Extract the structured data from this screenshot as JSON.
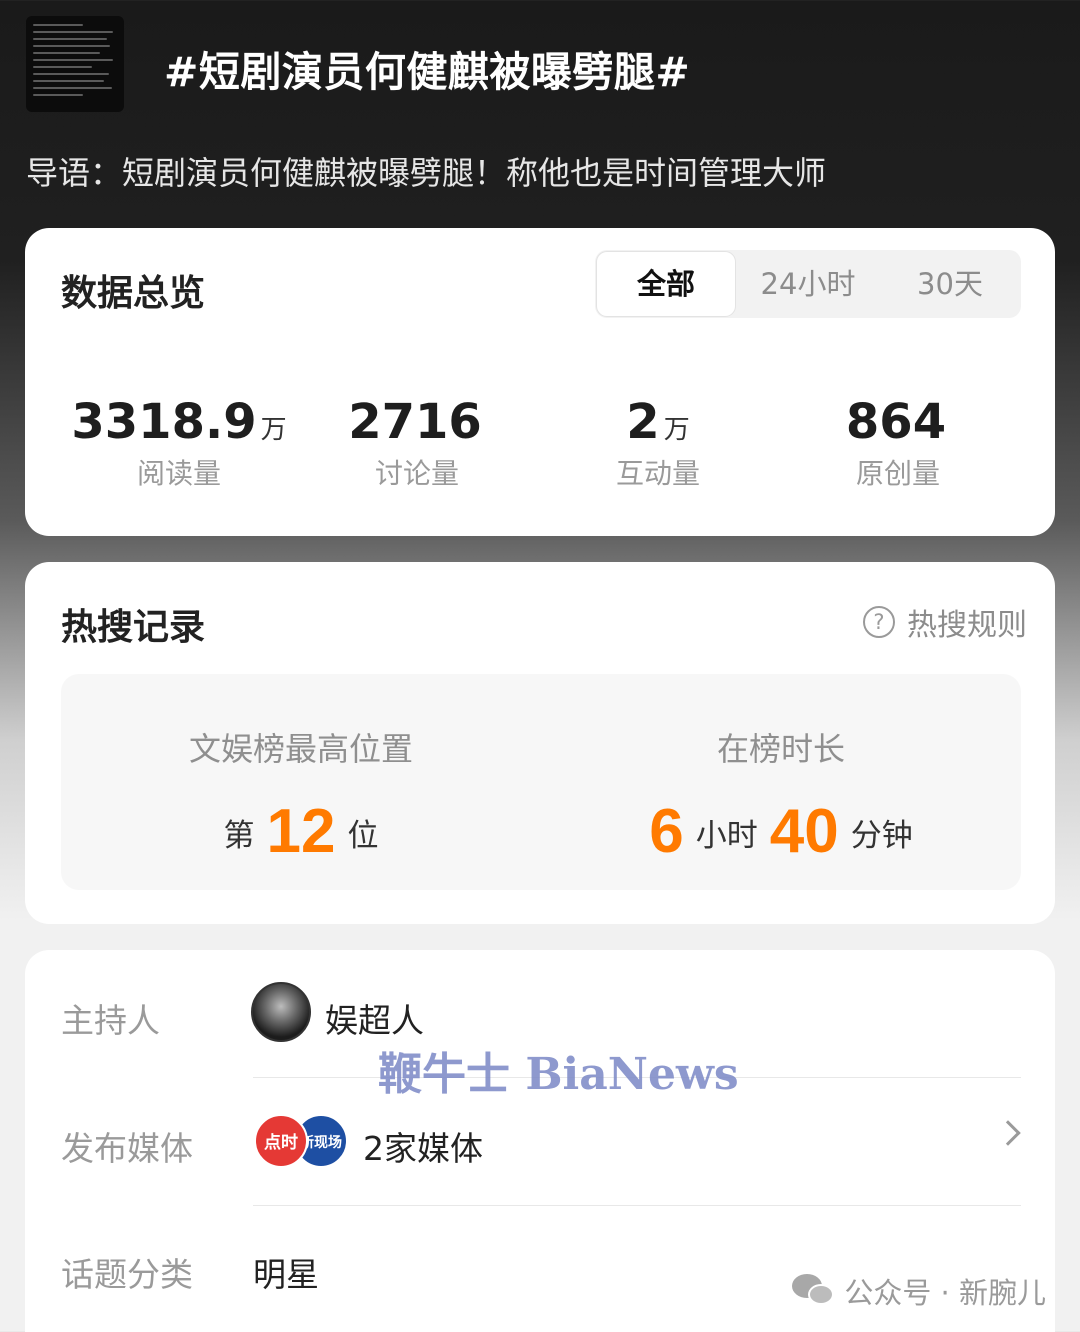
{
  "topic": {
    "title": "#短剧演员何健麒被曝劈腿#",
    "intro": "导语：短剧演员何健麒被曝劈腿！称他也是时间管理大师"
  },
  "overview": {
    "title": "数据总览",
    "tabs": [
      {
        "label": "全部",
        "selected": true
      },
      {
        "label": "24小时",
        "selected": false
      },
      {
        "label": "30天",
        "selected": false
      }
    ],
    "stats": [
      {
        "value": "3318.9",
        "unit": "万",
        "label": "阅读量"
      },
      {
        "value": "2716",
        "unit": "",
        "label": "讨论量"
      },
      {
        "value": "2",
        "unit": "万",
        "label": "互动量"
      },
      {
        "value": "864",
        "unit": "",
        "label": "原创量"
      }
    ]
  },
  "hot_search": {
    "title": "热搜记录",
    "rules_label": "热搜规则",
    "rules_icon": "question-circle-icon",
    "best_rank": {
      "label": "文娱榜最高位置",
      "prefix": "第",
      "value": "12",
      "suffix": "位"
    },
    "duration": {
      "label": "在榜时长",
      "hours": "6",
      "hours_unit": "小时",
      "minutes": "40",
      "minutes_unit": "分钟"
    }
  },
  "info": {
    "host_label": "主持人",
    "host_name": "娱超人",
    "media_label": "发布媒体",
    "media_badges": [
      {
        "text": "点时",
        "color": "#e53935"
      },
      {
        "text": "新现场",
        "color": "#1e4fa3"
      }
    ],
    "media_count": "2家媒体",
    "category_label": "话题分类",
    "category_value": "明星"
  },
  "overlays": {
    "watermark": "鞭牛士 BiaNews",
    "wechat_source": "公众号 · 新腕儿"
  },
  "colors": {
    "accent_orange": "#ff7a00",
    "watermark_blue": "#7b88c6"
  }
}
